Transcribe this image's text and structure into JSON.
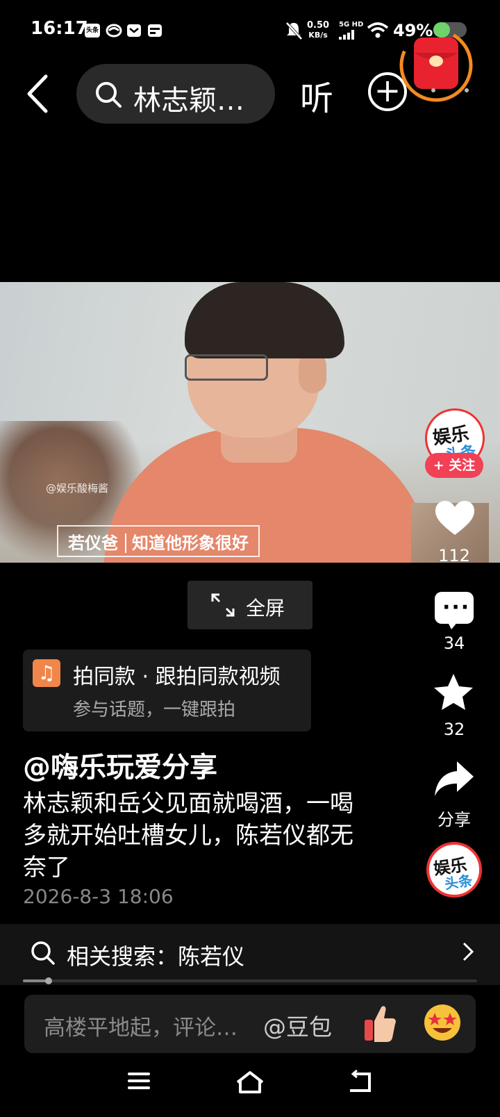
{
  "status_bar": {
    "time": "16:17",
    "net_speed_value": "0.50",
    "net_speed_unit": "KB/s",
    "network": "5G HD",
    "battery": "49%",
    "notif_icons": [
      "头条",
      "bilibili-icon",
      "mail-icon",
      "card-icon"
    ]
  },
  "top_bar": {
    "search_text": "林志颖…",
    "listen_label": "听",
    "add_label": "+"
  },
  "video": {
    "watermark": "@娱乐酸梅酱",
    "subtitle_name": "若仪爸",
    "subtitle_text": "知道他形象很好"
  },
  "side_actions": {
    "author_avatar_text_1": "娱乐",
    "author_avatar_text_2": "头条",
    "follow_label": "+ 关注",
    "like_count": "112",
    "comment_count": "34",
    "favorite_count": "32",
    "share_label": "分享"
  },
  "fullscreen": {
    "label": "全屏"
  },
  "shoot_same": {
    "title": "拍同款 · 跟拍同款视频",
    "subtitle": "参与话题，一键跟拍"
  },
  "post": {
    "author": "@嗨乐玩爱分享",
    "description": "林志颖和岳父见面就喝酒，一喝多就开始吐槽女儿，陈若仪都无奈了",
    "date": "2026-8-3 18:06"
  },
  "related_search": {
    "label": "相关搜索：陈若仪"
  },
  "comment_bar": {
    "placeholder": "高楼平地起，评论…",
    "mention": "@豆包"
  },
  "colors": {
    "background": "#000000",
    "follow_red": "#f24055",
    "card_bg": "#1c1c1c",
    "music_orange": "#f0864a"
  }
}
